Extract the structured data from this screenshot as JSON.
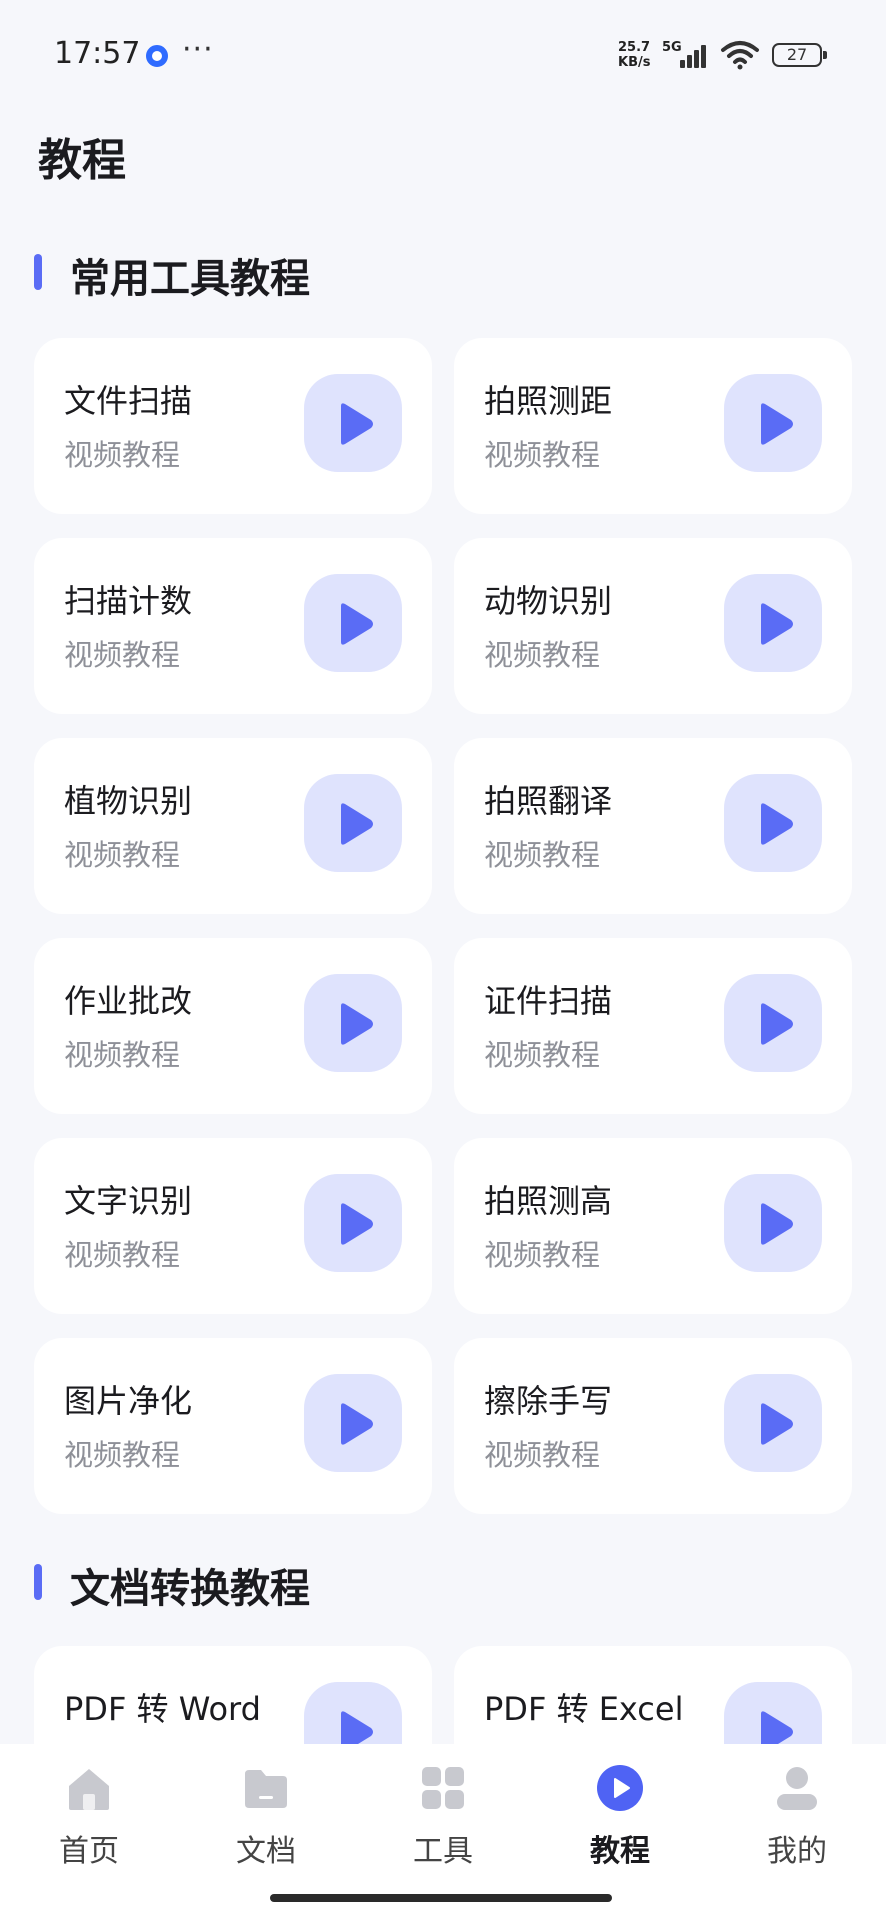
{
  "status_bar": {
    "time": "17:57",
    "more": "···",
    "net_speed_value": "25.7",
    "net_speed_unit": "KB/s",
    "network_type": "5G",
    "battery": "27"
  },
  "page_title": "教程",
  "sections": [
    {
      "title": "常用工具教程",
      "cards": [
        {
          "title": "文件扫描",
          "sub": "视频教程"
        },
        {
          "title": "拍照测距",
          "sub": "视频教程"
        },
        {
          "title": "扫描计数",
          "sub": "视频教程"
        },
        {
          "title": "动物识别",
          "sub": "视频教程"
        },
        {
          "title": "植物识别",
          "sub": "视频教程"
        },
        {
          "title": "拍照翻译",
          "sub": "视频教程"
        },
        {
          "title": "作业批改",
          "sub": "视频教程"
        },
        {
          "title": "证件扫描",
          "sub": "视频教程"
        },
        {
          "title": "文字识别",
          "sub": "视频教程"
        },
        {
          "title": "拍照测高",
          "sub": "视频教程"
        },
        {
          "title": "图片净化",
          "sub": "视频教程"
        },
        {
          "title": "擦除手写",
          "sub": "视频教程"
        }
      ]
    },
    {
      "title": "文档转换教程",
      "cards": [
        {
          "title": "PDF 转 Word",
          "sub": ""
        },
        {
          "title": "PDF 转 Excel",
          "sub": ""
        }
      ]
    }
  ],
  "bottom_nav": [
    {
      "label": "首页",
      "icon": "home-icon",
      "active": false
    },
    {
      "label": "文档",
      "icon": "folder-icon",
      "active": false
    },
    {
      "label": "工具",
      "icon": "grid-icon",
      "active": false
    },
    {
      "label": "教程",
      "icon": "play-circle-icon",
      "active": true
    },
    {
      "label": "我的",
      "icon": "user-icon",
      "active": false
    }
  ],
  "colors": {
    "accent": "#5a6cf5",
    "play_bg": "#dfe3fd",
    "nav_inactive": "#c8c9cf",
    "background": "#f6f7fb"
  }
}
